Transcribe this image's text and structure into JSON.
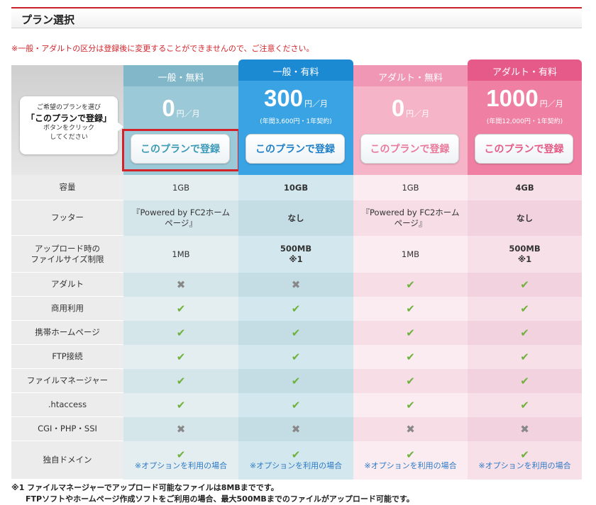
{
  "page": {
    "title": "プラン選択",
    "notice": "※一般・アダルトの区分は登録後に変更することができませんので、ご注意ください。"
  },
  "guide": {
    "line1": "ご希望のプランを選び",
    "line2": "「このプランで登録」",
    "line3": "ボタンをクリック",
    "line4": "してください"
  },
  "plans": [
    {
      "name": "一般・無料",
      "price": "0",
      "unit": "円／月",
      "sub": "",
      "button": "このプランで登録",
      "color": "#7db8cc"
    },
    {
      "name": "一般・有料",
      "price": "300",
      "unit": "円／月",
      "sub": "(年間3,600円・1年契約)",
      "button": "このプランで登録",
      "color": "#2b8fd6"
    },
    {
      "name": "アダルト・無料",
      "price": "0",
      "unit": "円／月",
      "sub": "",
      "button": "このプランで登録",
      "color": "#f19ab5"
    },
    {
      "name": "アダルト・有料",
      "price": "1000",
      "unit": "円／月",
      "sub": "(年間12,000円・1年契約)",
      "button": "このプランで登録",
      "color": "#e9668f"
    }
  ],
  "rows": [
    {
      "label": "容量",
      "values": [
        "1GB",
        "10GB",
        "1GB",
        "4GB"
      ]
    },
    {
      "label": "フッター",
      "values": [
        "『Powered by FC2ホームページ』",
        "なし",
        "『Powered by FC2ホームページ』",
        "なし"
      ]
    },
    {
      "label": "アップロード時の\nファイルサイズ制限",
      "values": [
        "1MB",
        "500MB\n※1",
        "1MB",
        "500MB\n※1"
      ]
    },
    {
      "label": "アダルト",
      "values": [
        "x",
        "x",
        "check",
        "check"
      ]
    },
    {
      "label": "商用利用",
      "values": [
        "check",
        "check",
        "check",
        "check"
      ]
    },
    {
      "label": "携帯ホームページ",
      "values": [
        "check",
        "check",
        "check",
        "check"
      ]
    },
    {
      "label": "FTP接続",
      "values": [
        "check",
        "check",
        "check",
        "check"
      ]
    },
    {
      "label": "ファイルマネージャー",
      "values": [
        "check",
        "check",
        "check",
        "check"
      ]
    },
    {
      "label": ".htaccess",
      "values": [
        "check",
        "check",
        "check",
        "check"
      ]
    },
    {
      "label": "CGI・PHP・SSI",
      "values": [
        "x",
        "x",
        "x",
        "x"
      ]
    },
    {
      "label": "独自ドメイン",
      "values": [
        "check",
        "check",
        "check",
        "check"
      ],
      "note": "※オプションを利用の場合"
    }
  ],
  "footnote": {
    "line1": "※1 ファイルマネージャーでアップロード可能なファイルは8MBまでです。",
    "line2": "FTPソフトやホームページ作成ソフトをご利用の場合、最大500MBまでのファイルがアップロード可能です。"
  },
  "icons": {
    "check": "check-icon",
    "cross": "cross-icon"
  },
  "colors": {
    "accent": "#c9202a",
    "highlight_box": "#d2232a"
  }
}
